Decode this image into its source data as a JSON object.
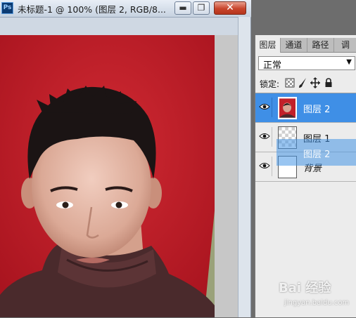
{
  "window": {
    "title": "未标题-1 @ 100% (图层 2, RGB/8...",
    "app_icon_label": "Ps",
    "minimize_label": "▬",
    "restore_label": "❐",
    "close_label": "✕"
  },
  "panel": {
    "tabs": [
      {
        "label": "图层",
        "active": true
      },
      {
        "label": "通道",
        "active": false
      },
      {
        "label": "路径",
        "active": false
      },
      {
        "label": "调",
        "active": false
      }
    ],
    "blend_mode": "正常",
    "lock_label": "锁定:",
    "layers": [
      {
        "name": "图层 2",
        "selected": true,
        "visible": true,
        "thumb": "photo-thumb"
      },
      {
        "name": "图层 1",
        "selected": false,
        "visible": true,
        "thumb": "transparent-thumb"
      },
      {
        "name": "背景",
        "selected": false,
        "visible": true,
        "thumb": "white-thumb"
      }
    ],
    "drag_ghost_name": "图层 2"
  },
  "icons": {
    "eye": "eye-icon",
    "lock_transparent": "lock-transparency-icon",
    "lock_brush": "brush-icon",
    "lock_move": "move-icon",
    "lock_all": "padlock-icon"
  },
  "colors": {
    "selected_layer": "#3f8fe6",
    "photo_background": "#c2202a",
    "close_button": "#c8452c"
  },
  "watermark": {
    "logo": "Bai 经验",
    "sub": "jingyan.baidu.com"
  }
}
